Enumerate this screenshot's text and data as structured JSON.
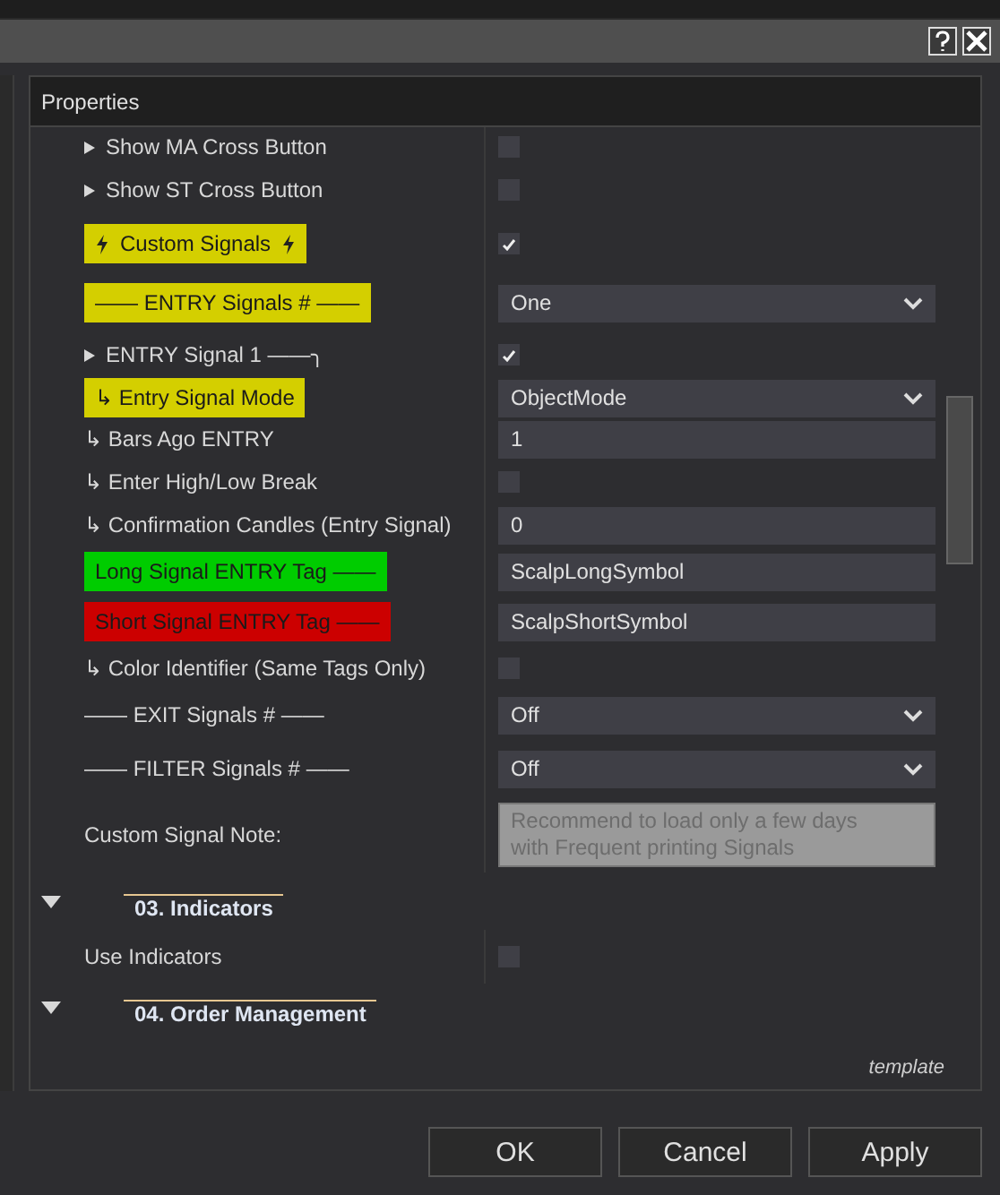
{
  "panel": {
    "title": "Properties",
    "footer": "template"
  },
  "rows": [
    {
      "kind": "property",
      "label": "Show MA Cross Button",
      "bullet": true,
      "value": {
        "kind": "check",
        "checked": false
      }
    },
    {
      "kind": "property",
      "label": "Show ST Cross Button",
      "bullet": true,
      "value": {
        "kind": "check",
        "checked": false
      }
    },
    {
      "kind": "property",
      "label": "Custom Signals",
      "bolts": true,
      "color": "#d4cf00",
      "value": {
        "kind": "check",
        "checked": true
      }
    },
    {
      "kind": "property",
      "label": "—— ENTRY Signals # ——",
      "color": "#d4cf00",
      "value": {
        "kind": "select",
        "text": "One"
      }
    },
    {
      "kind": "property",
      "label": "ENTRY Signal 1 ——╮",
      "bullet": true,
      "value": {
        "kind": "check",
        "checked": true
      }
    },
    {
      "kind": "property",
      "label": "↳ Entry Signal Mode",
      "color": "#d4cf00",
      "value": {
        "kind": "select",
        "text": "ObjectMode"
      }
    },
    {
      "kind": "property",
      "label": "↳ Bars Ago ENTRY",
      "value": {
        "kind": "text",
        "text": "1"
      }
    },
    {
      "kind": "property",
      "label": "↳ Enter High/Low Break",
      "value": {
        "kind": "check",
        "checked": false
      }
    },
    {
      "kind": "property",
      "label": "↳ Confirmation Candles (Entry Signal)",
      "value": {
        "kind": "text",
        "text": "0"
      }
    },
    {
      "kind": "property",
      "label": "Long Signal ENTRY Tag ——",
      "color": "#00cc00",
      "value": {
        "kind": "text",
        "text": "ScalpLongSymbol"
      }
    },
    {
      "kind": "property",
      "label": "Short Signal ENTRY Tag ——",
      "color": "#cc0000",
      "value": {
        "kind": "text",
        "text": "ScalpShortSymbol"
      }
    },
    {
      "kind": "property",
      "label": "↳ Color Identifier (Same Tags Only)",
      "value": {
        "kind": "check",
        "checked": false
      }
    },
    {
      "kind": "property",
      "label": "—— EXIT Signals # ——",
      "value": {
        "kind": "select",
        "text": "Off"
      }
    },
    {
      "kind": "property",
      "label": "—— FILTER Signals # ——",
      "value": {
        "kind": "select",
        "text": "Off"
      }
    },
    {
      "kind": "property",
      "label": "Custom Signal Note:",
      "value": {
        "kind": "note",
        "text": "Recommend to load only a few days\nwith Frequent printing Signals"
      }
    },
    {
      "kind": "category",
      "label": "03. Indicators",
      "expanded": true
    },
    {
      "kind": "property",
      "label": "Use Indicators",
      "value": {
        "kind": "check",
        "checked": false
      }
    },
    {
      "kind": "category",
      "label": "04. Order Management",
      "expanded": true
    }
  ],
  "buttons": [
    "OK",
    "Cancel",
    "Apply"
  ]
}
